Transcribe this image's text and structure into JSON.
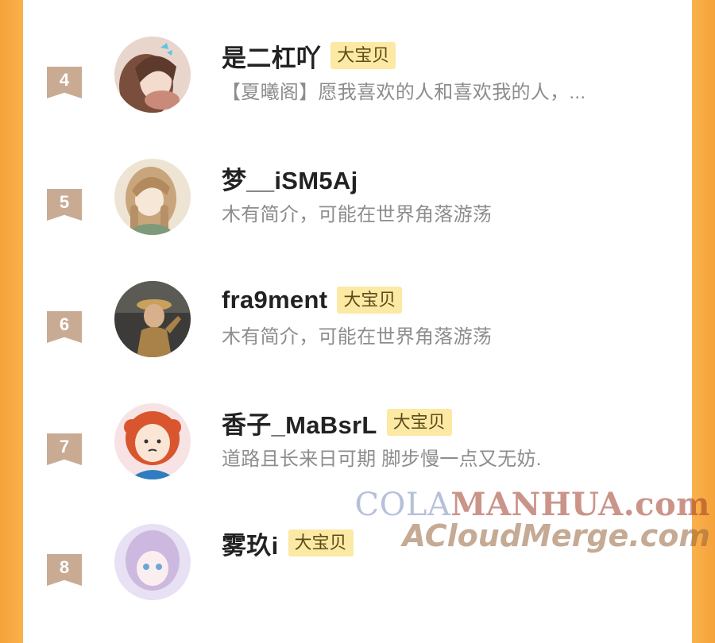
{
  "rows": [
    {
      "rank": "4",
      "name": "是二杠吖",
      "badge": "大宝贝",
      "bio": "【夏曦阁】愿我喜欢的人和喜欢我的人，..."
    },
    {
      "rank": "5",
      "name": "梦__iSM5Aj",
      "badge": "",
      "bio": "木有简介，可能在世界角落游荡"
    },
    {
      "rank": "6",
      "name": "fra9ment",
      "badge": "大宝贝",
      "bio": "木有简介，可能在世界角落游荡"
    },
    {
      "rank": "7",
      "name": "香子_MaBsrL",
      "badge": "大宝贝",
      "bio": "道路且长来日可期 脚步慢一点又无妨."
    },
    {
      "rank": "8",
      "name": "雾玖i",
      "badge": "大宝贝",
      "bio": ""
    }
  ],
  "watermark": {
    "line1_a": "COLA",
    "line1_b": "MANHUA.com",
    "line2": "ACloudMerge.com"
  },
  "colors": {
    "side": "#f9b24c",
    "rank": "#c9ab94",
    "badge": "#fbe9a4"
  }
}
